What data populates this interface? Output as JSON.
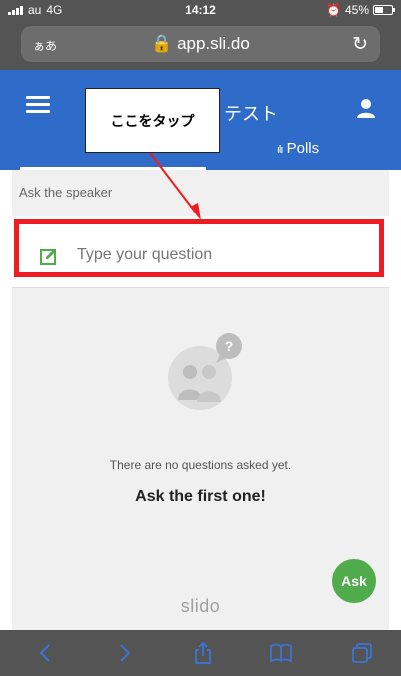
{
  "status_bar": {
    "carrier": "au",
    "network": "4G",
    "time": "14:12",
    "battery": "45%"
  },
  "browser": {
    "text_size_button": "ぁあ",
    "url": "app.sli.do"
  },
  "header": {
    "event_title": "テスト"
  },
  "tabs": [
    {
      "label": ""
    },
    {
      "label": "Polls"
    }
  ],
  "main": {
    "section_label": "Ask the speaker",
    "question_placeholder": "Type your question",
    "empty_message": "There are no questions asked yet.",
    "empty_cta": "Ask the first one!",
    "brand": "slido"
  },
  "ask_button": {
    "label": "Ask",
    "color": "#4fab4b"
  },
  "annotation": {
    "callout_text": "ここをタップ",
    "highlight_color": "#ee1d23"
  },
  "colors": {
    "header_bg": "#2f6bc8",
    "content_bg": "#f0f0f0",
    "browser_chrome": "#545454"
  }
}
